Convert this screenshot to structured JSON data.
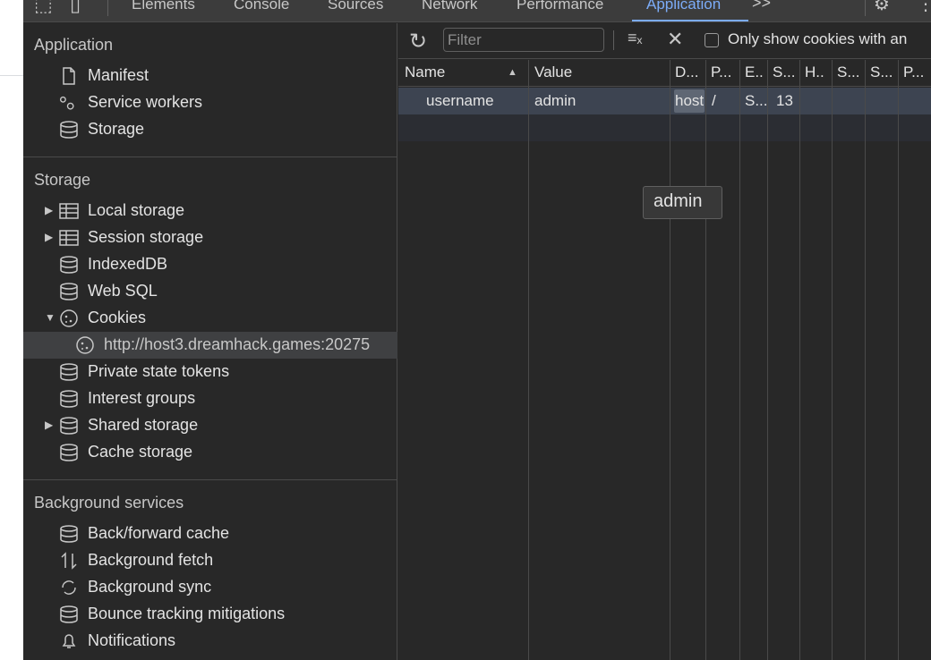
{
  "tabs": [
    "Elements",
    "Console",
    "Sources",
    "Network",
    "Performance",
    "Application"
  ],
  "more_tabs": ">>",
  "sidebar": {
    "application": {
      "title": "Application",
      "items": [
        {
          "label": "Manifest",
          "icon": "document-icon"
        },
        {
          "label": "Service workers",
          "icon": "gears-icon"
        },
        {
          "label": "Storage",
          "icon": "database-icon"
        }
      ]
    },
    "storage": {
      "title": "Storage",
      "items": [
        {
          "label": "Local storage",
          "icon": "table-icon"
        },
        {
          "label": "Session storage",
          "icon": "table-icon"
        },
        {
          "label": "IndexedDB",
          "icon": "database-icon"
        },
        {
          "label": "Web SQL",
          "icon": "database-icon"
        },
        {
          "label": "Cookies",
          "icon": "cookie-icon"
        },
        {
          "label": "http://host3.dreamhack.games:20275",
          "icon": "cookie-icon"
        },
        {
          "label": "Private state tokens",
          "icon": "database-icon"
        },
        {
          "label": "Interest groups",
          "icon": "database-icon"
        },
        {
          "label": "Shared storage",
          "icon": "database-icon"
        },
        {
          "label": "Cache storage",
          "icon": "database-icon"
        }
      ]
    },
    "background": {
      "title": "Background services",
      "items": [
        {
          "label": "Back/forward cache",
          "icon": "database-icon"
        },
        {
          "label": "Background fetch",
          "icon": "arrows-updown-icon"
        },
        {
          "label": "Background sync",
          "icon": "sync-icon"
        },
        {
          "label": "Bounce tracking mitigations",
          "icon": "database-icon"
        },
        {
          "label": "Notifications",
          "icon": "bell-icon"
        }
      ]
    }
  },
  "toolbar": {
    "filter_placeholder": "Filter",
    "only_show_label": "Only show cookies with an"
  },
  "grid": {
    "headers": [
      "Name",
      "Value",
      "D...",
      "P...",
      "E..",
      "S...",
      "H..",
      "S...",
      "S...",
      "P..."
    ],
    "rows": [
      {
        "name": "username",
        "value": "admin",
        "domain": "host",
        "path": "/",
        "expires": "S...",
        "size": "13"
      }
    ]
  },
  "tooltip": "admin",
  "colors": {
    "accent": "#7cacf8",
    "background": "#282828",
    "row_selected": "#3d4451"
  }
}
